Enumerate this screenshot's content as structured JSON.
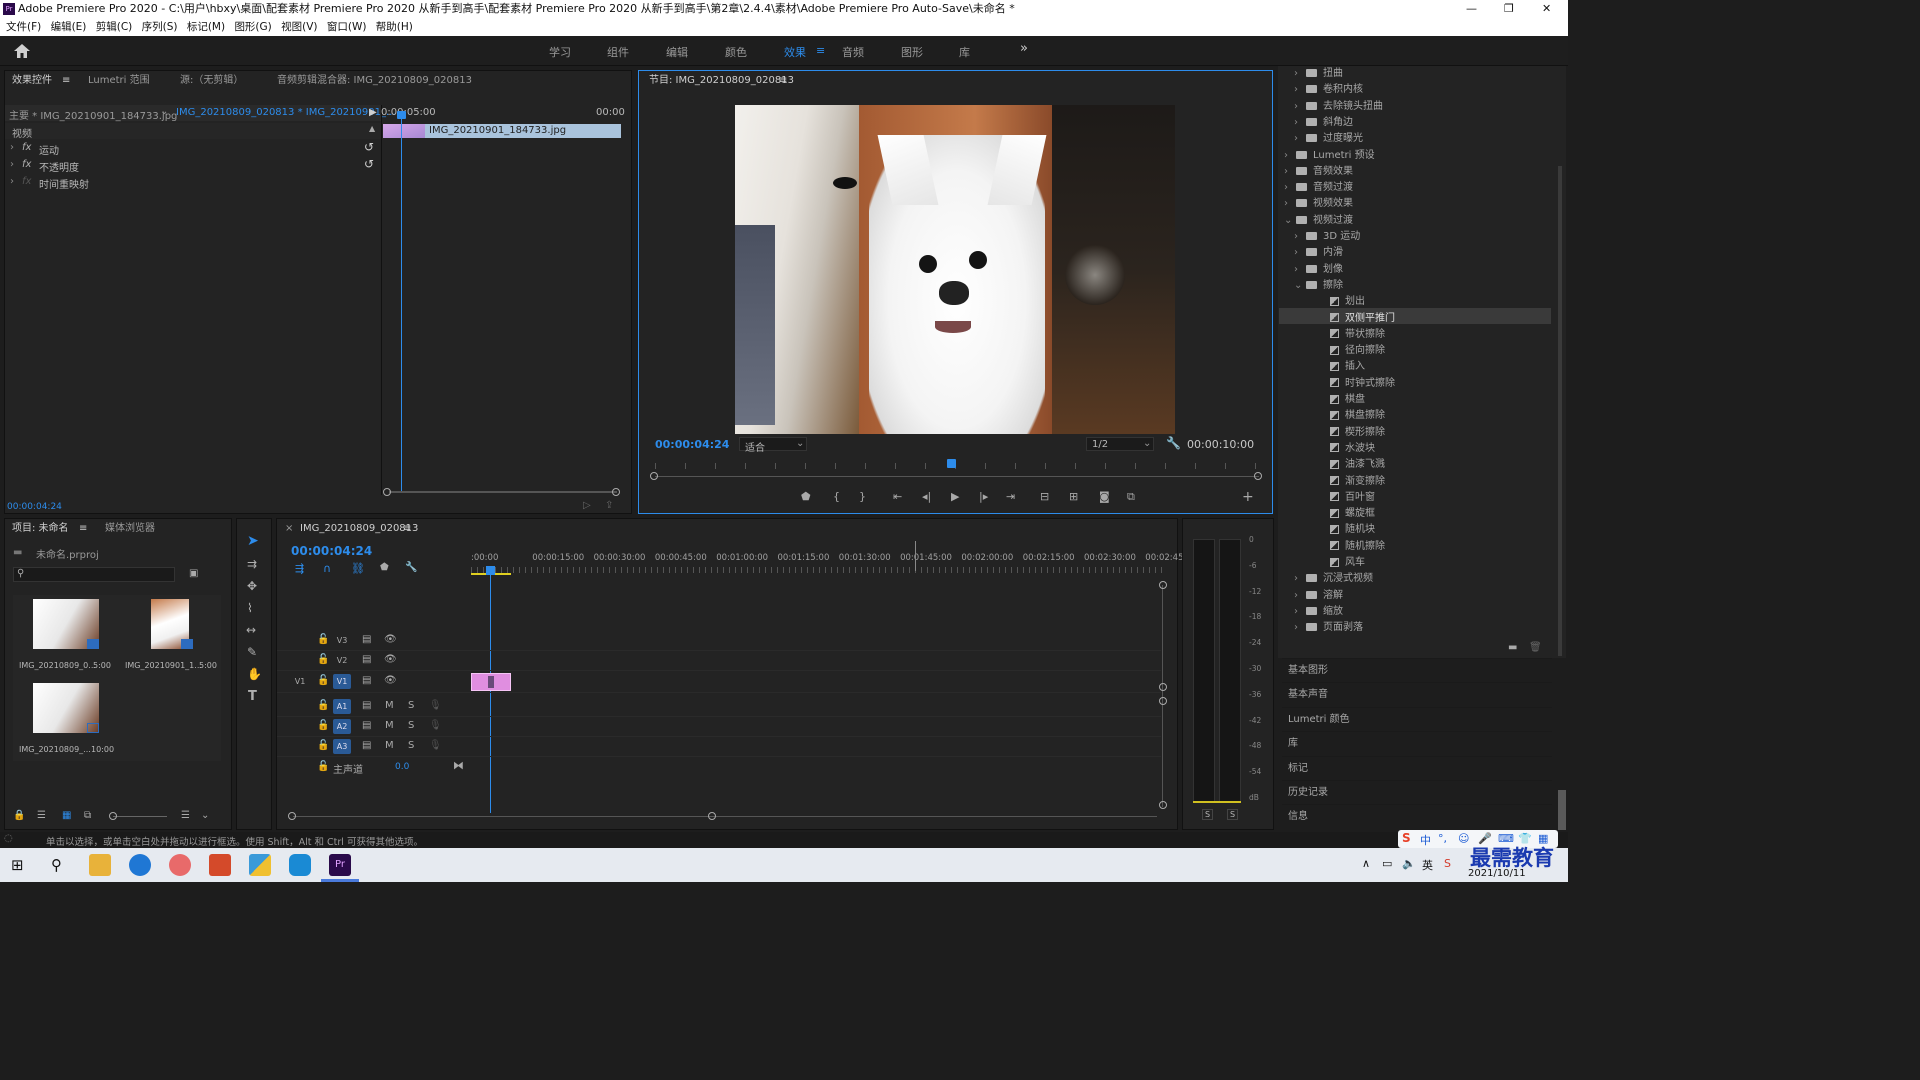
{
  "window": {
    "title": "Adobe Premiere Pro 2020 - C:\\用户\\hbxy\\桌面\\配套素材 Premiere Pro 2020 从新手到高手\\配套素材 Premiere Pro 2020 从新手到高手\\第2章\\2.4.4\\素材\\Adobe Premiere Pro Auto-Save\\未命名 *",
    "min": "—",
    "max": "❐",
    "close": "✕"
  },
  "menu": [
    "文件(F)",
    "编辑(E)",
    "剪辑(C)",
    "序列(S)",
    "标记(M)",
    "图形(G)",
    "视图(V)",
    "窗口(W)",
    "帮助(H)"
  ],
  "workspaces": [
    "学习",
    "组件",
    "编辑",
    "颜色",
    "效果",
    "音频",
    "图形",
    "库"
  ],
  "workspace_more": "»",
  "effect_controls": {
    "tabs": [
      "效果控件",
      "Lumetri 范围",
      "源:（无剪辑）",
      "音频剪辑混合器: IMG_20210809_020813"
    ],
    "master": "主要 * IMG_20210901_184733.jpg",
    "sequence": "IMG_20210809_020813 * IMG_20210901_...",
    "time_start": "0:00:05:00",
    "time_end": "00:00",
    "section": "视频",
    "props": [
      "运动",
      "不透明度",
      "时间重映射"
    ],
    "clip": "IMG_20210901_184733.jpg",
    "timecode": "00:00:04:24",
    "fx": "fx"
  },
  "program": {
    "title": "节目: IMG_20210809_020813",
    "timecode": "00:00:04:24",
    "fit": "适合",
    "resolution": "1/2",
    "duration": "00:00:10:00"
  },
  "project": {
    "tabs": [
      "项目: 未命名",
      "媒体浏览器"
    ],
    "file": "未命名.prproj",
    "items": [
      {
        "name": "IMG_20210809_0...",
        "dur": "5:00"
      },
      {
        "name": "IMG_20210901_1...",
        "dur": "5:00"
      },
      {
        "name": "IMG_20210809_...",
        "dur": "10:00"
      }
    ]
  },
  "timeline": {
    "tab": "IMG_20210809_020813",
    "close": "×",
    "timecode": "00:00:04:24",
    "ruler": [
      ":00:00",
      "00:00:15:00",
      "00:00:30:00",
      "00:00:45:00",
      "00:01:00:00",
      "00:01:15:00",
      "00:01:30:00",
      "00:01:45:00",
      "00:02:00:00",
      "00:02:15:00",
      "00:02:30:00",
      "00:02:45:"
    ],
    "video_tracks": [
      "V3",
      "V2",
      "V1"
    ],
    "source_patch": "V1",
    "audio_tracks": [
      "A1",
      "A2",
      "A3"
    ],
    "master": "主声道",
    "master_val": "0.0",
    "mute": "M",
    "solo": "S"
  },
  "meter": {
    "scale": [
      "0",
      "-6",
      "-12",
      "-18",
      "-24",
      "-30",
      "-36",
      "-42",
      "-48",
      "-54",
      "dB"
    ],
    "solo": [
      "S",
      "S"
    ]
  },
  "effects_tree": [
    {
      "label": "扭曲",
      "level": 1,
      "type": "folder"
    },
    {
      "label": "卷积内核",
      "level": 1,
      "type": "folder"
    },
    {
      "label": "去除镜头扭曲",
      "level": 1,
      "type": "folder"
    },
    {
      "label": "斜角边",
      "level": 1,
      "type": "folder"
    },
    {
      "label": "过度曝光",
      "level": 1,
      "type": "folder"
    },
    {
      "label": "Lumetri 预设",
      "level": 0,
      "type": "folder"
    },
    {
      "label": "音频效果",
      "level": 0,
      "type": "folder"
    },
    {
      "label": "音频过渡",
      "level": 0,
      "type": "folder"
    },
    {
      "label": "视频效果",
      "level": 0,
      "type": "folder"
    },
    {
      "label": "视频过渡",
      "level": 0,
      "type": "folder",
      "open": true
    },
    {
      "label": "3D 运动",
      "level": 1,
      "type": "folder"
    },
    {
      "label": "内滑",
      "level": 1,
      "type": "folder"
    },
    {
      "label": "划像",
      "level": 1,
      "type": "folder"
    },
    {
      "label": "擦除",
      "level": 1,
      "type": "folder",
      "open": true
    },
    {
      "label": "划出",
      "level": 2,
      "type": "fx"
    },
    {
      "label": "双侧平推门",
      "level": 2,
      "type": "fx",
      "selected": true
    },
    {
      "label": "带状擦除",
      "level": 2,
      "type": "fx"
    },
    {
      "label": "径向擦除",
      "level": 2,
      "type": "fx"
    },
    {
      "label": "插入",
      "level": 2,
      "type": "fx"
    },
    {
      "label": "时钟式擦除",
      "level": 2,
      "type": "fx"
    },
    {
      "label": "棋盘",
      "level": 2,
      "type": "fx"
    },
    {
      "label": "棋盘擦除",
      "level": 2,
      "type": "fx"
    },
    {
      "label": "楔形擦除",
      "level": 2,
      "type": "fx"
    },
    {
      "label": "水波块",
      "level": 2,
      "type": "fx"
    },
    {
      "label": "油漆飞溅",
      "level": 2,
      "type": "fx"
    },
    {
      "label": "渐变擦除",
      "level": 2,
      "type": "fx"
    },
    {
      "label": "百叶窗",
      "level": 2,
      "type": "fx"
    },
    {
      "label": "螺旋框",
      "level": 2,
      "type": "fx"
    },
    {
      "label": "随机块",
      "level": 2,
      "type": "fx"
    },
    {
      "label": "随机擦除",
      "level": 2,
      "type": "fx"
    },
    {
      "label": "风车",
      "level": 2,
      "type": "fx"
    },
    {
      "label": "沉浸式视频",
      "level": 1,
      "type": "folder"
    },
    {
      "label": "溶解",
      "level": 1,
      "type": "folder"
    },
    {
      "label": "缩放",
      "level": 1,
      "type": "folder"
    },
    {
      "label": "页面剥落",
      "level": 1,
      "type": "folder"
    }
  ],
  "right_panels": [
    "基本图形",
    "基本声音",
    "Lumetri 颜色",
    "库",
    "标记",
    "历史记录",
    "信息"
  ],
  "status": "单击以选择，或单击空白处并拖动以进行框选。使用 Shift，Alt 和 Ctrl 可获得其他选项。",
  "tray": {
    "date": "2021/10/11",
    "watermark": "最需教育",
    "ime": "中"
  },
  "colors": {
    "accent": "#2d8ceb",
    "clip": "#e08ee0",
    "panel": "#232323"
  }
}
